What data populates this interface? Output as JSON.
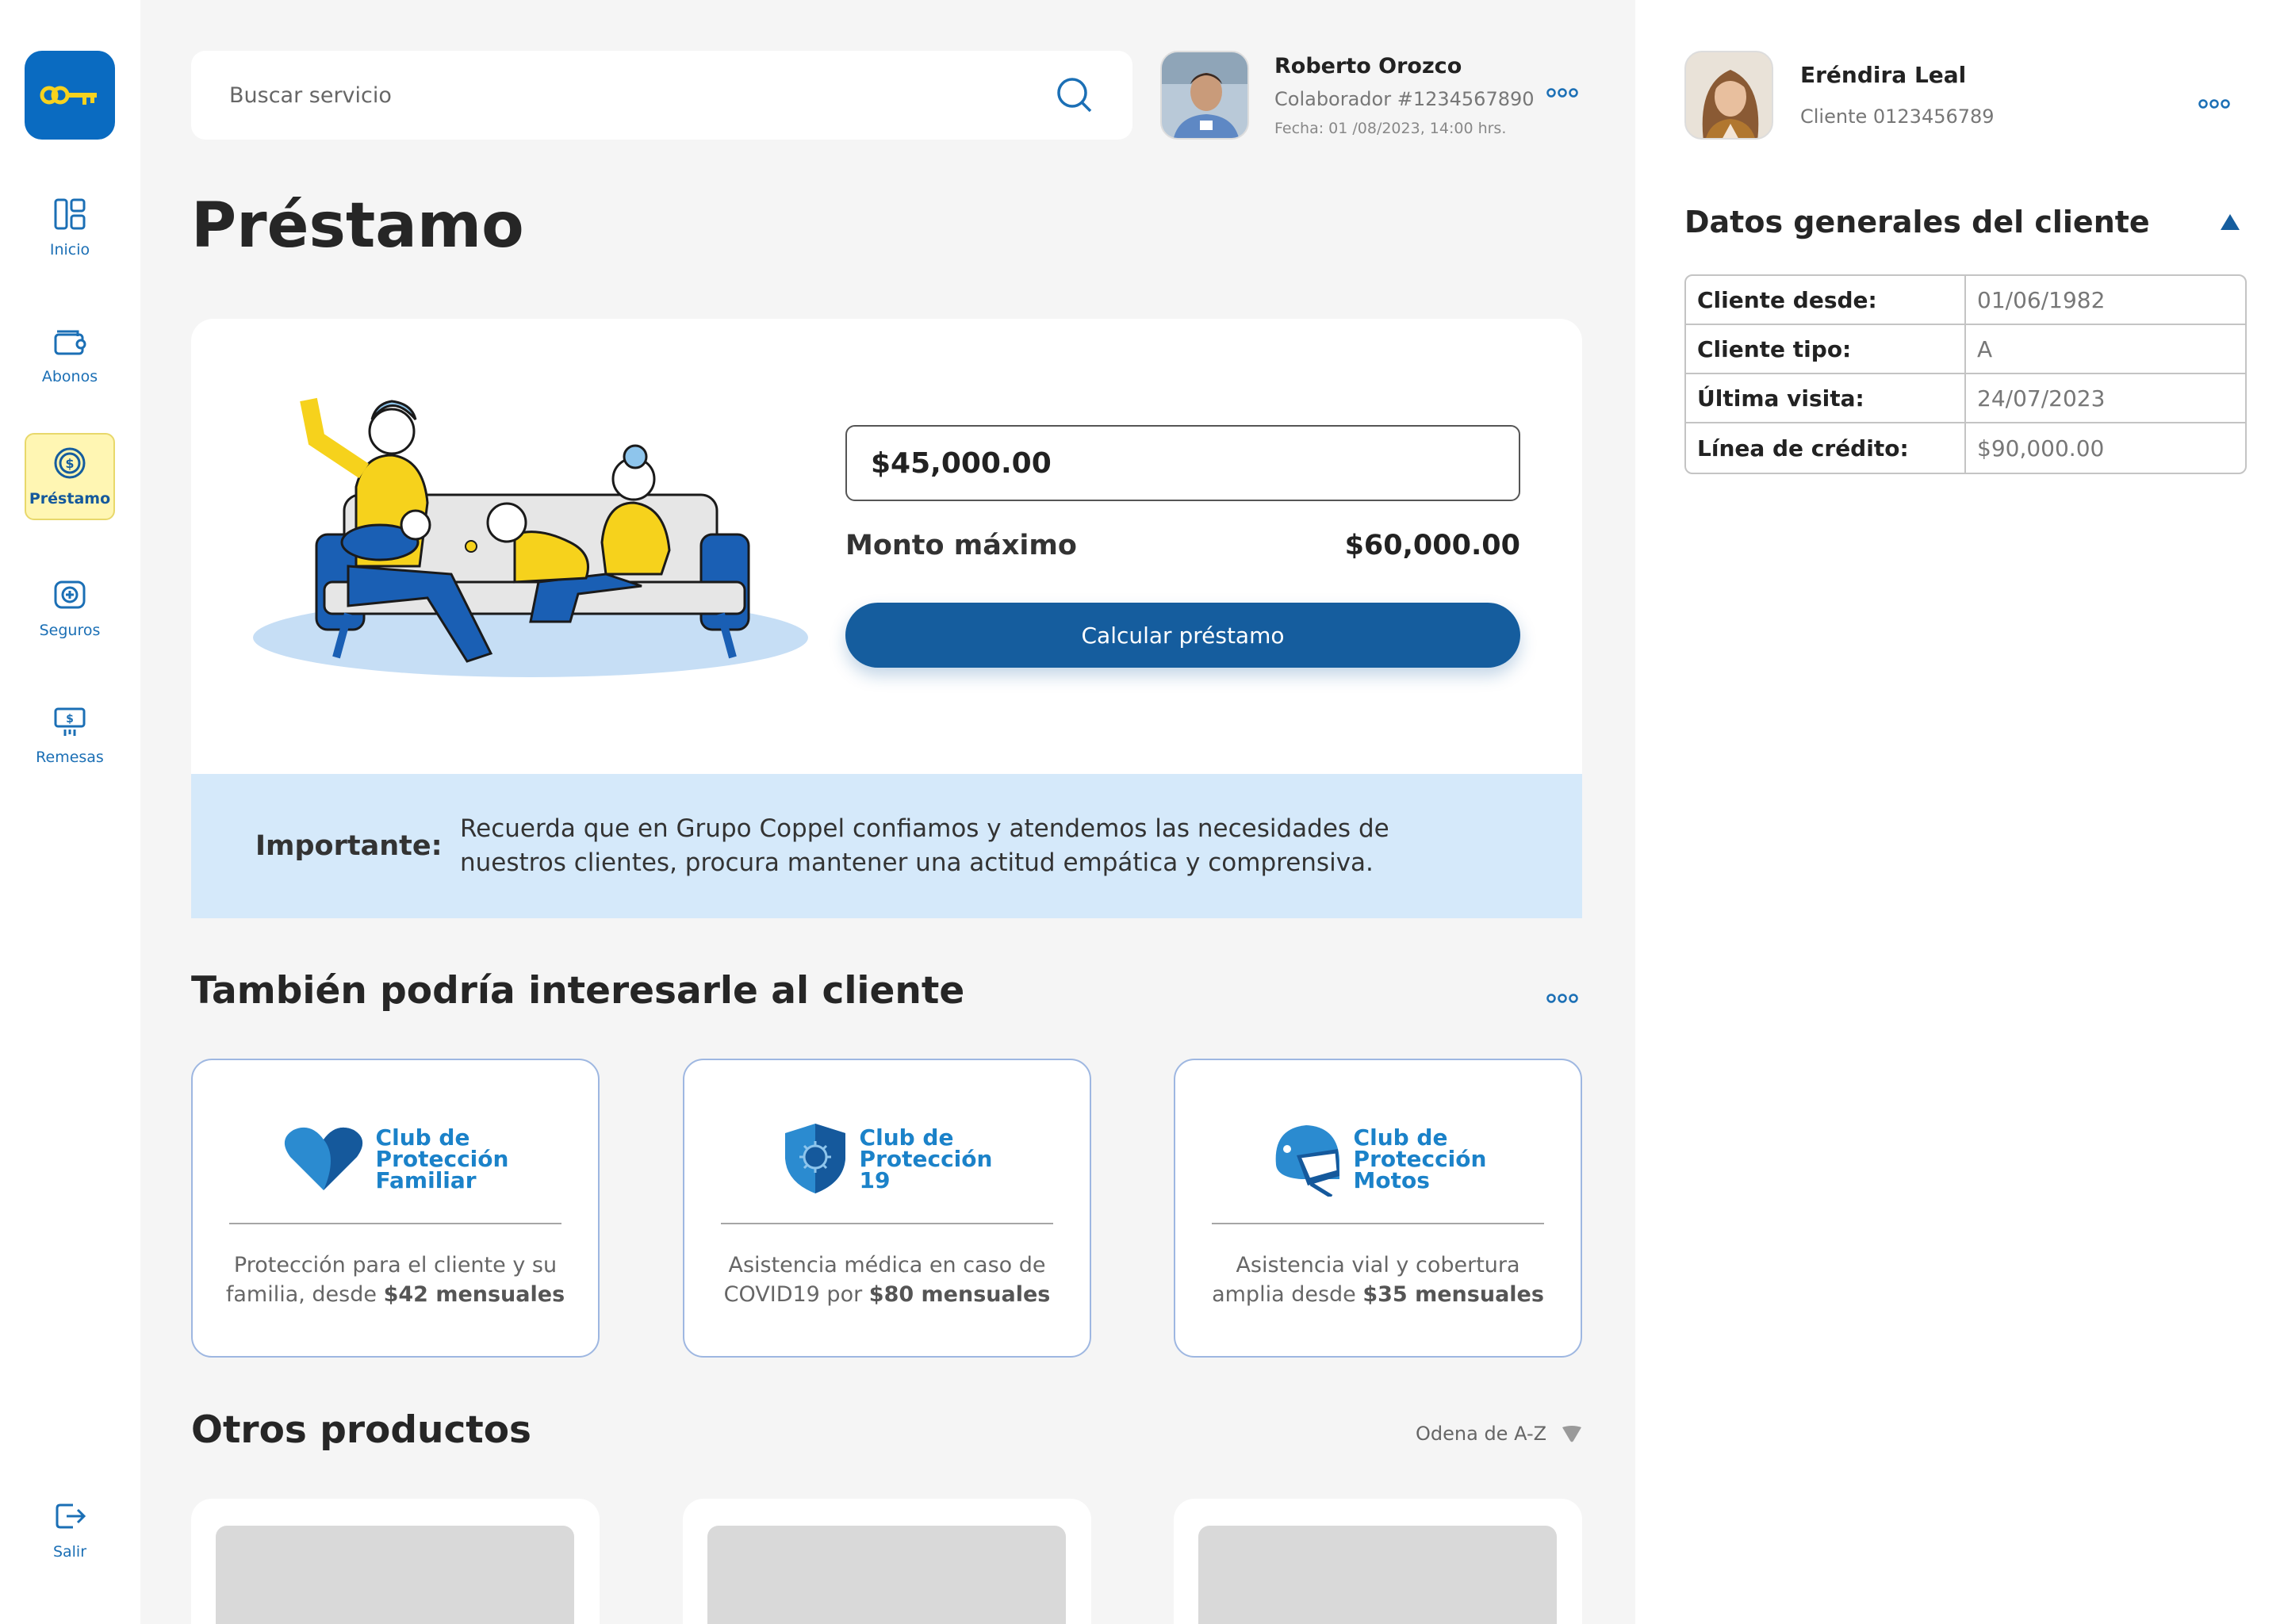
{
  "sidebar": {
    "logo_icon": "key-icon",
    "items": [
      {
        "label": "Inicio",
        "icon": "dashboard-icon"
      },
      {
        "label": "Abonos",
        "icon": "wallet-icon"
      },
      {
        "label": "Préstamo",
        "icon": "dollar-coin-icon",
        "active": true
      },
      {
        "label": "Seguros",
        "icon": "medical-cross-icon"
      },
      {
        "label": "Remesas",
        "icon": "cash-transfer-icon"
      }
    ],
    "logout": {
      "label": "Salir",
      "icon": "logout-icon"
    }
  },
  "search": {
    "placeholder": "Buscar servicio"
  },
  "collaborator": {
    "name": "Roberto Orozco",
    "id": "Colaborador #1234567890",
    "date": "Fecha: 01 /08/2023, 14:00 hrs."
  },
  "page": {
    "title": "Préstamo"
  },
  "loan": {
    "amount": "$45,000.00",
    "max_label": "Monto máximo",
    "max_value": "$60,000.00",
    "button": "Calcular préstamo"
  },
  "notice": {
    "label": "Importante:",
    "text": "Recuerda que en Grupo Coppel confiamos y atendemos las necesidades de nuestros clientes, procura mantener una actitud empática y comprensiva."
  },
  "suggestions": {
    "title": "También podría interesarle al cliente",
    "cards": [
      {
        "logo_lines": [
          "Club de",
          "Protección",
          "Familiar"
        ],
        "icon": "heart-icon",
        "desc": "Protección para el cliente y su familia, desde ",
        "price": "$42 mensuales"
      },
      {
        "logo_lines": [
          "Club de",
          "Protección",
          "19"
        ],
        "icon": "virus-shield-icon",
        "desc": "Asistencia médica en caso de COVID19 por ",
        "price": "$80 mensuales"
      },
      {
        "logo_lines": [
          "Club de",
          "Protección",
          "Motos"
        ],
        "icon": "helmet-icon",
        "desc": "Asistencia vial y cobertura amplia desde ",
        "price": "$35 mensuales"
      }
    ]
  },
  "products": {
    "title": "Otros productos",
    "sort_label": "Odena de A-Z"
  },
  "client": {
    "name": "Eréndira Leal",
    "id": "Cliente 0123456789",
    "panel_title": "Datos generales del cliente",
    "rows": [
      {
        "key": "Cliente desde:",
        "value": "01/06/1982"
      },
      {
        "key": "Cliente tipo:",
        "value": "A"
      },
      {
        "key": "Última visita:",
        "value": "24/07/2023"
      },
      {
        "key": "Línea de crédito:",
        "value": "$90,000.00"
      }
    ]
  },
  "colors": {
    "primary": "#155d9e",
    "accent": "#1b82c9",
    "highlight": "#fff6b3",
    "notice_bg": "#d5e9fa"
  }
}
